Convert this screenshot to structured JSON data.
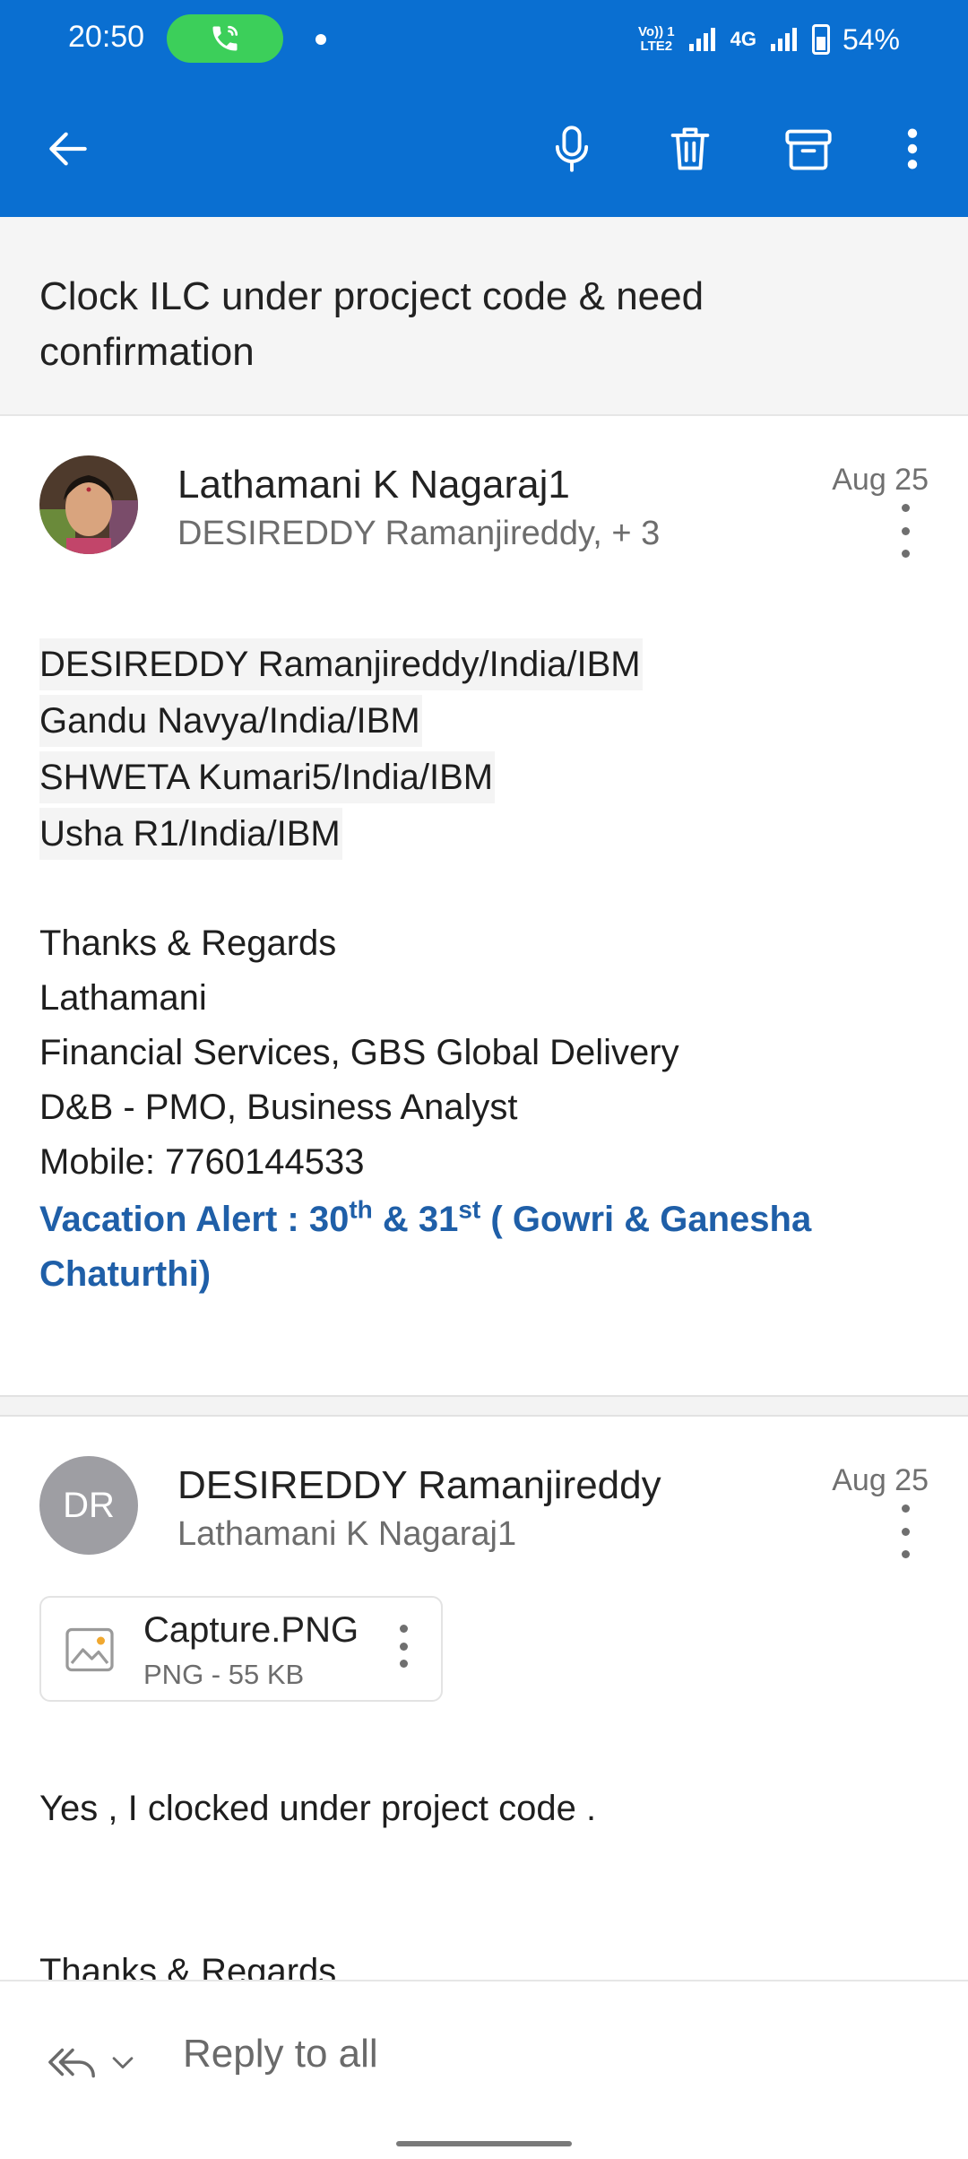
{
  "status_bar": {
    "time": "20:50",
    "volte_line1": "Vo)) 1",
    "volte_line2": "LTE2",
    "network": "4G",
    "battery": "54%"
  },
  "subject": "Clock ILC under procject code & need confirmation",
  "message1": {
    "sender": "Lathamani K Nagaraj1",
    "recipients": "DESIREDDY Ramanjireddy, + 3",
    "date": "Aug 25",
    "to_lines": [
      "DESIREDDY Ramanjireddy/India/IBM",
      "Gandu Navya/India/IBM",
      "SHWETA Kumari5/India/IBM",
      "Usha R1/India/IBM"
    ],
    "signature": [
      "Thanks & Regards",
      "Lathamani",
      "Financial Services, GBS Global Delivery",
      "D&B - PMO, Business Analyst",
      "Mobile: 7760144533"
    ],
    "vacation": {
      "prefix": "Vacation Alert :  30",
      "sup1": "th",
      "mid": " & 31",
      "sup2": "st",
      "suffix": " ( Gowri & Ganesha Chaturthi)"
    }
  },
  "message2": {
    "avatar_initials": "DR",
    "sender": "DESIREDDY Ramanjireddy",
    "recipients": "Lathamani K Nagaraj1",
    "date": "Aug 25",
    "attachment": {
      "name": "Capture.PNG",
      "meta": "PNG - 55 KB"
    },
    "body": "Yes , I clocked under project code .",
    "signature_partial": "Thanks & Regards"
  },
  "reply_bar": {
    "label": "Reply to all"
  },
  "colors": {
    "appbar": "#0a6fd1",
    "link_blue": "#1f5fa8",
    "call_green": "#3ccf5a"
  }
}
